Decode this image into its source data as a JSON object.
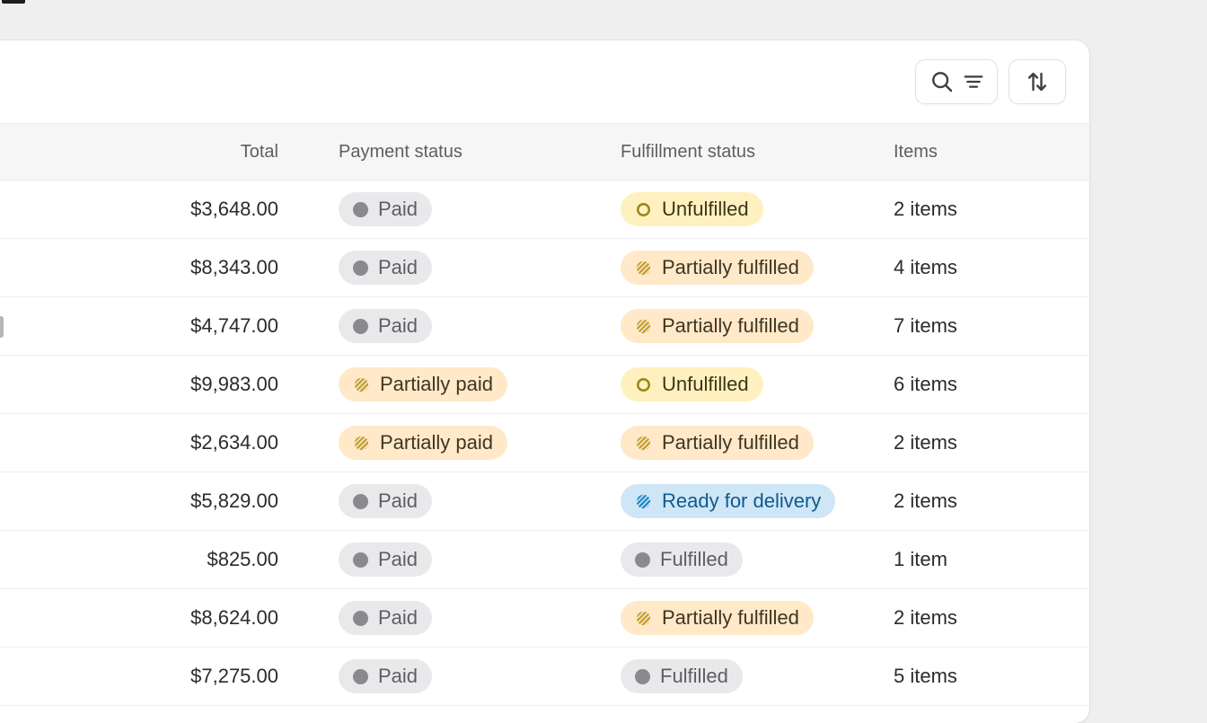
{
  "page": {
    "background_color": "#efefef",
    "card_background": "#ffffff"
  },
  "toolbar": {
    "search_filter_button_label": "Search and filter",
    "search_icon": "search-icon",
    "filter_icon": "filter-icon",
    "sort_button_label": "Sort",
    "sort_icon": "sort-arrows-icon"
  },
  "table": {
    "columns": [
      {
        "key": "order",
        "label": ""
      },
      {
        "key": "total",
        "label": "Total"
      },
      {
        "key": "payment_status",
        "label": "Payment status"
      },
      {
        "key": "fulfillment_status",
        "label": "Fulfillment status"
      },
      {
        "key": "items",
        "label": "Items"
      }
    ],
    "rows": [
      {
        "total": "$3,648.00",
        "payment_status": {
          "label": "Paid",
          "tone": "neutral",
          "icon": "filled-circle-icon"
        },
        "fulfillment_status": {
          "label": "Unfulfilled",
          "tone": "attention",
          "icon": "hollow-circle-icon"
        },
        "items": "2 items"
      },
      {
        "total": "$8,343.00",
        "payment_status": {
          "label": "Paid",
          "tone": "neutral",
          "icon": "filled-circle-icon"
        },
        "fulfillment_status": {
          "label": "Partially fulfilled",
          "tone": "warning",
          "icon": "hatched-circle-icon"
        },
        "items": "4 items"
      },
      {
        "total": "$4,747.00",
        "payment_status": {
          "label": "Paid",
          "tone": "neutral",
          "icon": "filled-circle-icon"
        },
        "fulfillment_status": {
          "label": "Partially fulfilled",
          "tone": "warning",
          "icon": "hatched-circle-icon"
        },
        "items": "7 items"
      },
      {
        "total": "$9,983.00",
        "payment_status": {
          "label": "Partially paid",
          "tone": "warning",
          "icon": "hatched-circle-icon"
        },
        "fulfillment_status": {
          "label": "Unfulfilled",
          "tone": "attention",
          "icon": "hollow-circle-icon"
        },
        "items": "6 items"
      },
      {
        "total": "$2,634.00",
        "payment_status": {
          "label": "Partially paid",
          "tone": "warning",
          "icon": "hatched-circle-icon"
        },
        "fulfillment_status": {
          "label": "Partially fulfilled",
          "tone": "warning",
          "icon": "hatched-circle-icon"
        },
        "items": "2 items"
      },
      {
        "total": "$5,829.00",
        "payment_status": {
          "label": "Paid",
          "tone": "neutral",
          "icon": "filled-circle-icon"
        },
        "fulfillment_status": {
          "label": "Ready for delivery",
          "tone": "info",
          "icon": "hatched-circle-icon"
        },
        "items": "2 items"
      },
      {
        "total": "$825.00",
        "payment_status": {
          "label": "Paid",
          "tone": "neutral",
          "icon": "filled-circle-icon"
        },
        "fulfillment_status": {
          "label": "Fulfilled",
          "tone": "neutral",
          "icon": "filled-circle-icon"
        },
        "items": "1 item"
      },
      {
        "total": "$8,624.00",
        "payment_status": {
          "label": "Paid",
          "tone": "neutral",
          "icon": "filled-circle-icon"
        },
        "fulfillment_status": {
          "label": "Partially fulfilled",
          "tone": "warning",
          "icon": "hatched-circle-icon"
        },
        "items": "2 items"
      },
      {
        "total": "$7,275.00",
        "payment_status": {
          "label": "Paid",
          "tone": "neutral",
          "icon": "filled-circle-icon"
        },
        "fulfillment_status": {
          "label": "Fulfilled",
          "tone": "neutral",
          "icon": "filled-circle-icon"
        },
        "items": "5 items"
      }
    ]
  },
  "colors": {
    "neutral_badge_bg": "#e9e9eb",
    "neutral_badge_dot": "#8a8a8e",
    "warning_badge_bg": "#ffe9c8",
    "warning_badge_icon": "#c79a25",
    "attention_badge_bg": "#fff1bf",
    "attention_badge_icon": "#9b8416",
    "info_badge_bg": "#cfe6f7",
    "info_badge_icon": "#1a84c7",
    "header_row_bg": "#f6f6f7",
    "row_divider": "#eeeef0"
  }
}
